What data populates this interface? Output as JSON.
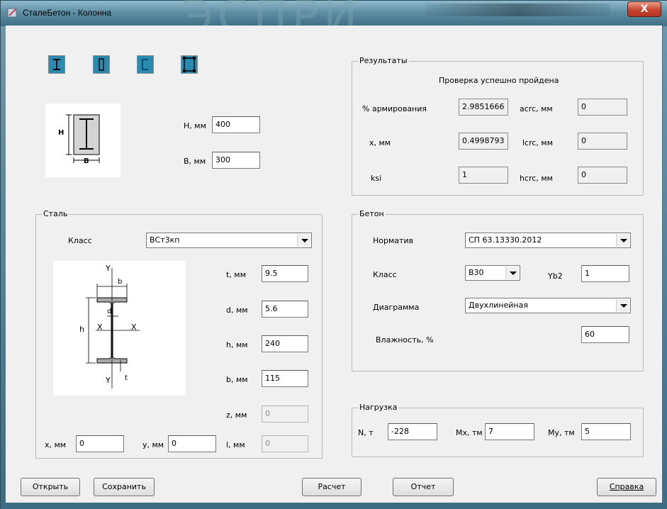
{
  "window": {
    "title": "СталеБетон - Колонна",
    "close_label": "X",
    "title_art": "ЭСПРИ"
  },
  "section_icons": [
    "i-beam-section-icon",
    "channel-section-icon",
    "box-section-icon",
    "tube-section-icon"
  ],
  "dims": {
    "h_label": "H, мм",
    "h_value": "400",
    "b_label": "B, мм",
    "b_value": "300",
    "diagram_h": "H",
    "diagram_b": "B"
  },
  "results": {
    "title": "Результаты",
    "status": "Проверка успешно пройдена",
    "reinf_label": "% армирования",
    "reinf_value": "2.9851666",
    "x_label": "x, мм",
    "x_value": "0.4998793",
    "ksi_label": "ksi",
    "ksi_value": "1",
    "acrc_label": "acrc, мм",
    "acrc_value": "0",
    "lcrc_label": "lcrc, мм",
    "lcrc_value": "0",
    "hcrc_label": "hcrc, мм",
    "hcrc_value": "0"
  },
  "steel": {
    "title": "Сталь",
    "class_label": "Класс",
    "class_value": "ВСт3кп",
    "t_label": "t, мм",
    "t_value": "9.5",
    "d_label": "d, мм",
    "d_value": "5.6",
    "h_label": "h, мм",
    "h_value": "240",
    "b_label": "b, мм",
    "b_value": "115",
    "z_label": "z, мм",
    "z_value": "0",
    "l_label": "l, мм",
    "l_value": "0",
    "x_label": "x, мм",
    "x_value": "0",
    "y_label": "y, мм",
    "y_value": "0",
    "diag": {
      "Y_top": "Y",
      "b": "b",
      "d": "d",
      "h": "h",
      "X_left": "X",
      "X_right": "X",
      "Y_bottom": "Y",
      "t": "t"
    }
  },
  "concrete": {
    "title": "Бетон",
    "norm_label": "Норматив",
    "norm_value": "СП 63.13330.2012",
    "class_label": "Класс",
    "class_value": "B30",
    "yb2_label": "Yb2",
    "yb2_value": "1",
    "diagram_label": "Диаграмма",
    "diagram_value": "Двухлинейная",
    "humidity_label": "Влажность, %",
    "humidity_value": "60"
  },
  "load": {
    "title": "Нагрузка",
    "n_label": "N, т",
    "n_value": "-228",
    "mx_label": "Mx, тм",
    "mx_value": "7",
    "my_label": "My, тм",
    "my_value": "5"
  },
  "buttons": {
    "open": "Открыть",
    "save": "Сохранить",
    "calc": "Расчет",
    "report": "Отчет",
    "help": "Справка"
  }
}
